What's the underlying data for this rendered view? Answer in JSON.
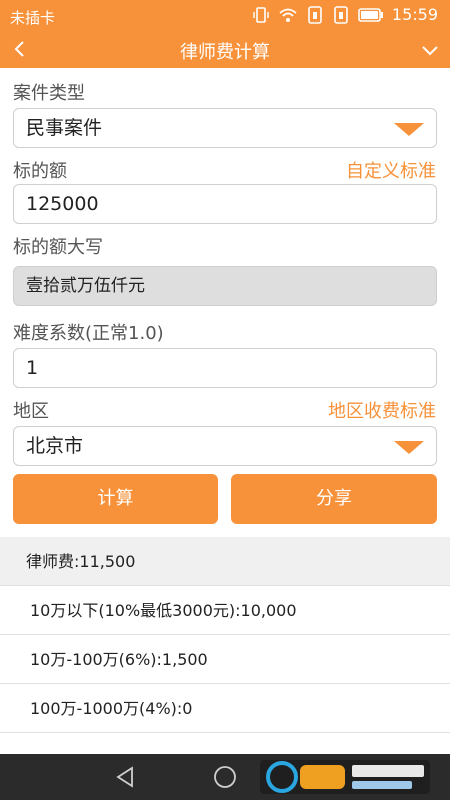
{
  "status_bar": {
    "carrier": "未插卡",
    "time": "15:59",
    "icons": [
      "vibrate-icon",
      "wifi-icon",
      "sim1-icon",
      "sim2-icon",
      "battery-icon"
    ]
  },
  "header": {
    "title": "律师费计算",
    "back_icon": "chevron-left-icon",
    "menu_icon": "chevron-down-icon"
  },
  "form": {
    "case_type_label": "案件类型",
    "case_type_value": "民事案件",
    "amount_label": "标的额",
    "custom_standard_link": "自定义标准",
    "amount_value": "125000",
    "amount_upper_label": "标的额大写",
    "amount_upper_value": "壹拾贰万伍仟元",
    "difficulty_label": "难度系数(正常1.0)",
    "difficulty_value": "1",
    "region_label": "地区",
    "region_standard_link": "地区收费标准",
    "region_value": "北京市"
  },
  "buttons": {
    "calculate": "计算",
    "share": "分享"
  },
  "results": {
    "total": "律师费:11,500",
    "rows": [
      "10万以下(10%最低3000元):10,000",
      "10万-100万(6%):1,500",
      "100万-1000万(4%):0"
    ]
  },
  "colors": {
    "accent": "#f7923a",
    "nav_bar": "#2b2b2b"
  }
}
